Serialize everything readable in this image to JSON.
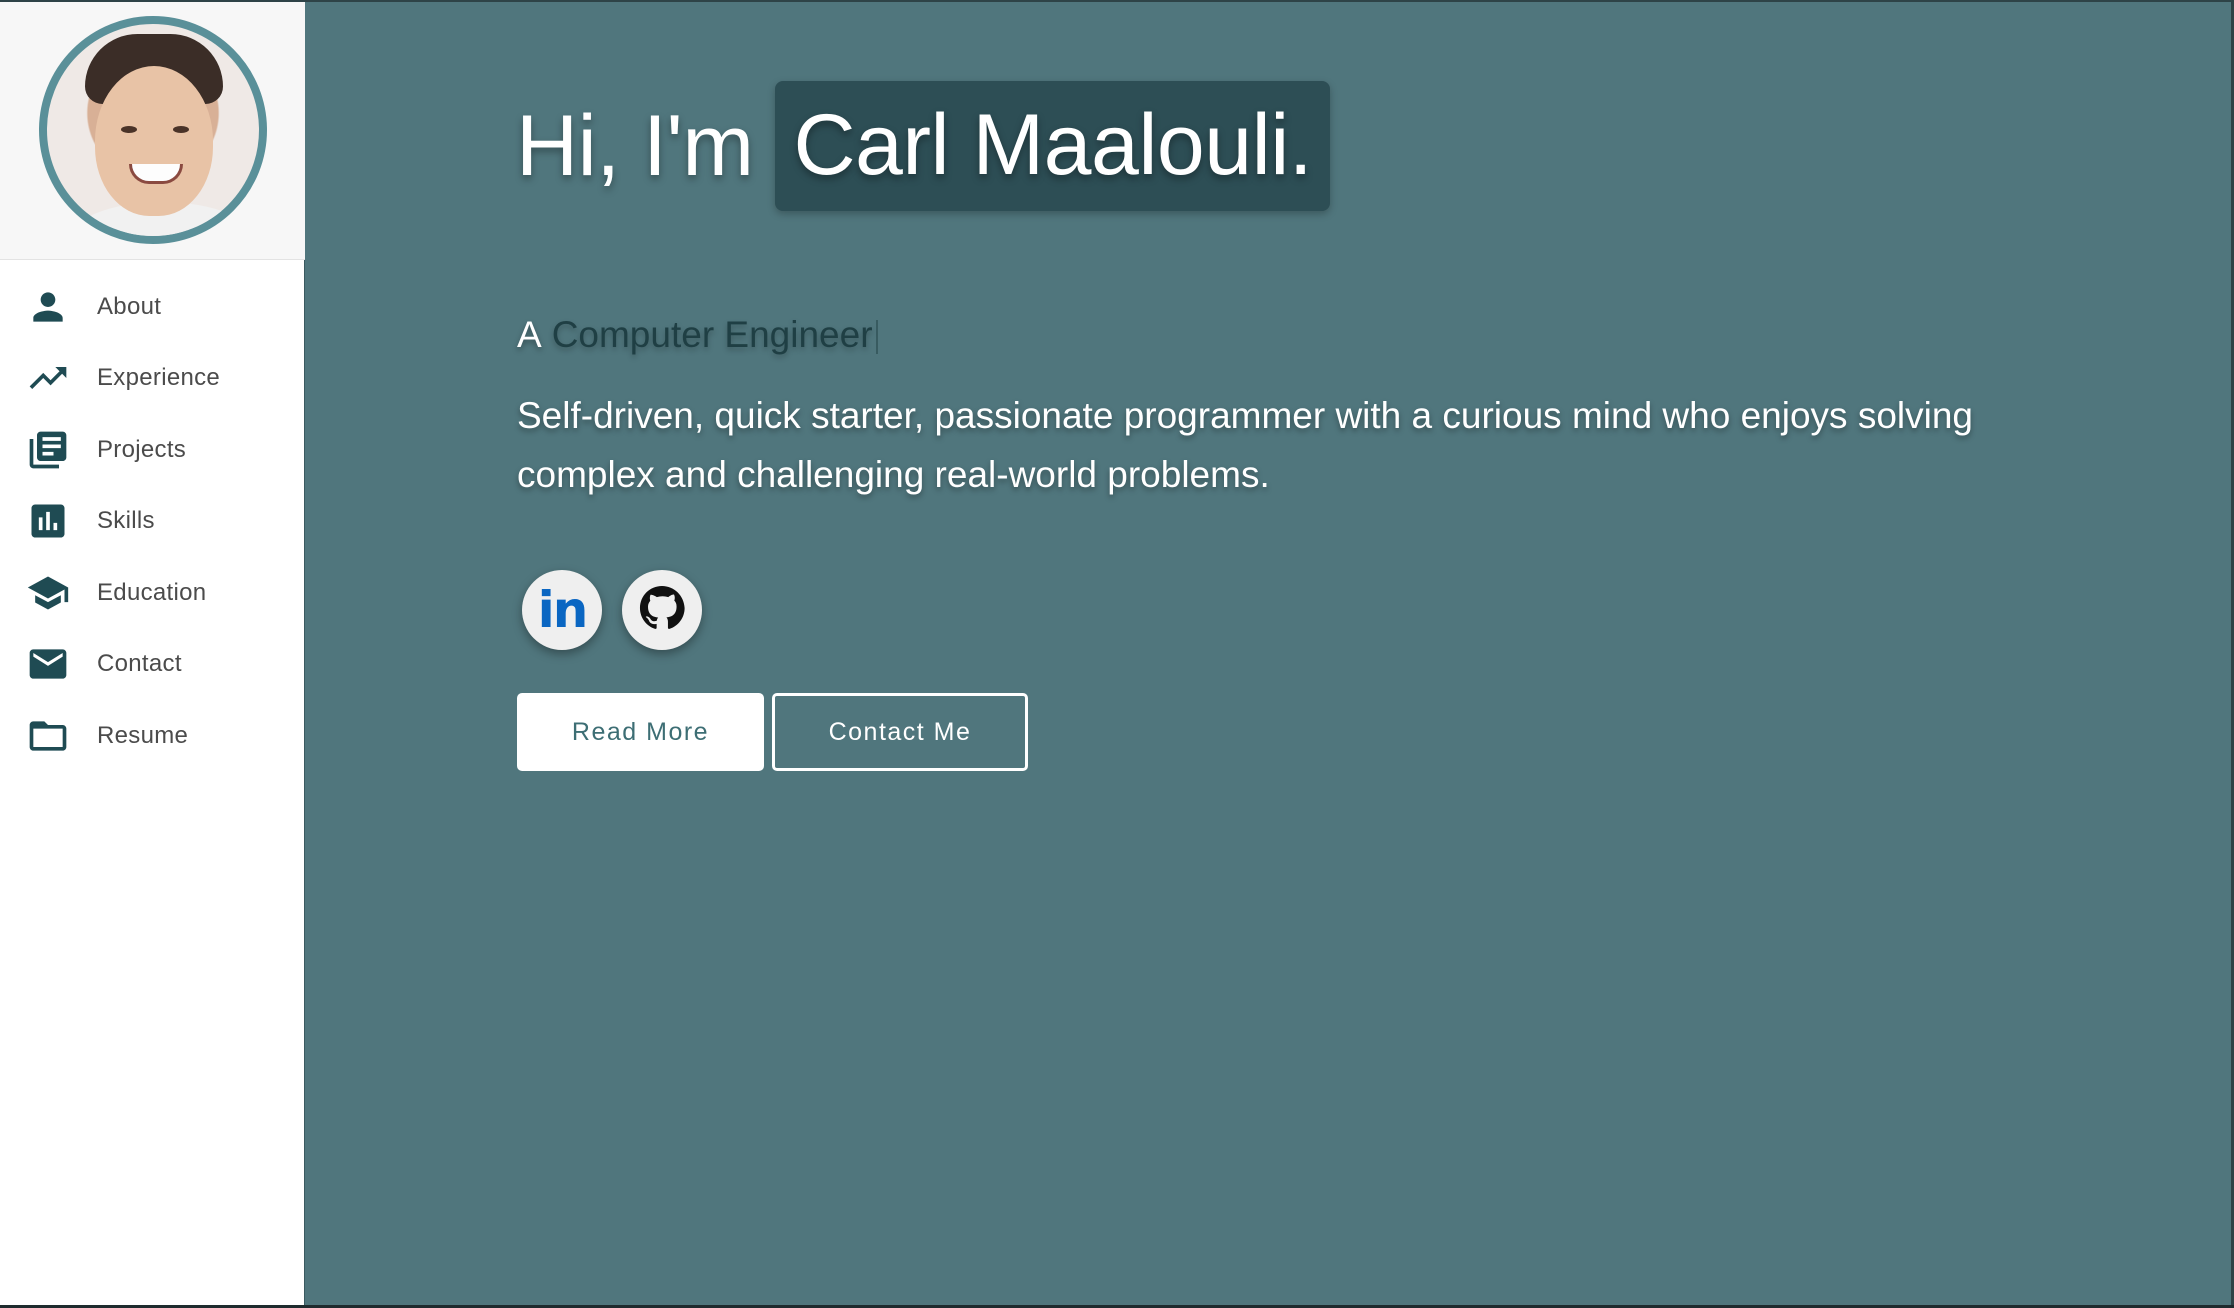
{
  "sidebar": {
    "avatar_alt": "Profile photo",
    "items": [
      {
        "label": "About",
        "icon": "person-icon"
      },
      {
        "label": "Experience",
        "icon": "trending-up-icon"
      },
      {
        "label": "Projects",
        "icon": "library-books-icon"
      },
      {
        "label": "Skills",
        "icon": "bar-chart-icon"
      },
      {
        "label": "Education",
        "icon": "graduation-cap-icon"
      },
      {
        "label": "Contact",
        "icon": "mail-icon"
      },
      {
        "label": "Resume",
        "icon": "folder-icon"
      }
    ]
  },
  "hero": {
    "greeting": "Hi, I'm",
    "name": "Carl Maalouli.",
    "role_prefix": "A",
    "role_typed": "Computer Engineer",
    "tagline": "Self-driven, quick starter, passionate programmer with a curious mind who enjoys solving complex and challenging real-world problems.",
    "socials": [
      {
        "name": "LinkedIn",
        "icon": "linkedin-icon",
        "glyph": "in"
      },
      {
        "name": "GitHub",
        "icon": "github-icon"
      }
    ],
    "buttons": {
      "read_more": "Read More",
      "contact_me": "Contact Me"
    }
  },
  "colors": {
    "background": "#50767d",
    "sidebar_bg": "#ffffff",
    "accent_dark": "#2d4e55",
    "icon": "#1f4b53",
    "avatar_ring": "#5a9099",
    "linkedin_blue": "#0a66c2"
  }
}
